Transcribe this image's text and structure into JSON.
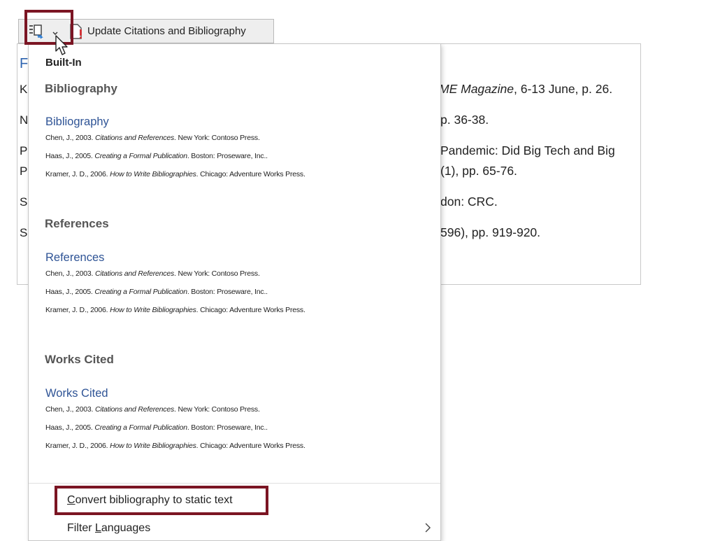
{
  "toolbar": {
    "update_label": "Update Citations and Bibliography"
  },
  "document": {
    "left_chars": [
      "F",
      "K",
      "N",
      "P",
      "P",
      "S",
      "S"
    ],
    "lines": [
      {
        "italic": "ME Magazine",
        "text": ", 6-13 June, p. 26."
      },
      {
        "italic": "",
        "text": "p. 36-38."
      },
      {
        "italic": "",
        "text": "Pandemic: Did Big Tech and Big"
      },
      {
        "italic": "",
        "text": "(1), pp. 65-76."
      },
      {
        "italic": "",
        "text": "don: CRC."
      },
      {
        "italic": "",
        "text": "596), pp. 919-920."
      }
    ]
  },
  "menu": {
    "heading": "Built-In",
    "groups": [
      {
        "header": "Bibliography",
        "title": "Bibliography",
        "entries": [
          {
            "pre": "Chen, J., 2003. ",
            "title": "Citations and References",
            "post": ". New York: Contoso Press."
          },
          {
            "pre": "Haas, J., 2005. ",
            "title": "Creating a Formal Publication",
            "post": ". Boston: Proseware, Inc.."
          },
          {
            "pre": "Kramer, J. D., 2006. ",
            "title": "How to Write Bibliographies",
            "post": ". Chicago: Adventure Works Press."
          }
        ]
      },
      {
        "header": "References",
        "title": "References",
        "entries": [
          {
            "pre": "Chen, J., 2003. ",
            "title": "Citations and References",
            "post": ". New York: Contoso Press."
          },
          {
            "pre": "Haas, J., 2005. ",
            "title": "Creating a Formal Publication",
            "post": ". Boston: Proseware, Inc.."
          },
          {
            "pre": "Kramer, J. D., 2006. ",
            "title": "How to Write Bibliographies",
            "post": ". Chicago: Adventure Works Press."
          }
        ]
      },
      {
        "header": "Works Cited",
        "title": "Works Cited",
        "entries": [
          {
            "pre": "Chen, J., 2003. ",
            "title": "Citations and References",
            "post": ". New York: Contoso Press."
          },
          {
            "pre": "Haas, J., 2005. ",
            "title": "Creating a Formal Publication",
            "post": ". Boston: Proseware, Inc.."
          },
          {
            "pre": "Kramer, J. D., 2006. ",
            "title": "How to Write Bibliographies",
            "post": ". Chicago: Adventure Works Press."
          }
        ]
      }
    ],
    "convert": {
      "accel": "C",
      "rest": "onvert bibliography to static text"
    },
    "filter": {
      "pre": "Filter ",
      "accel": "L",
      "rest": "anguages"
    }
  },
  "icons": {
    "citation": "citation-bibliography-icon",
    "update": "update-document-icon",
    "dropdown": "chevron-down-icon",
    "submenu": "chevron-right-icon",
    "cursor": "mouse-pointer-icon"
  },
  "colors": {
    "highlight_box": "#7b1523",
    "gallery_title": "#2f5496"
  }
}
